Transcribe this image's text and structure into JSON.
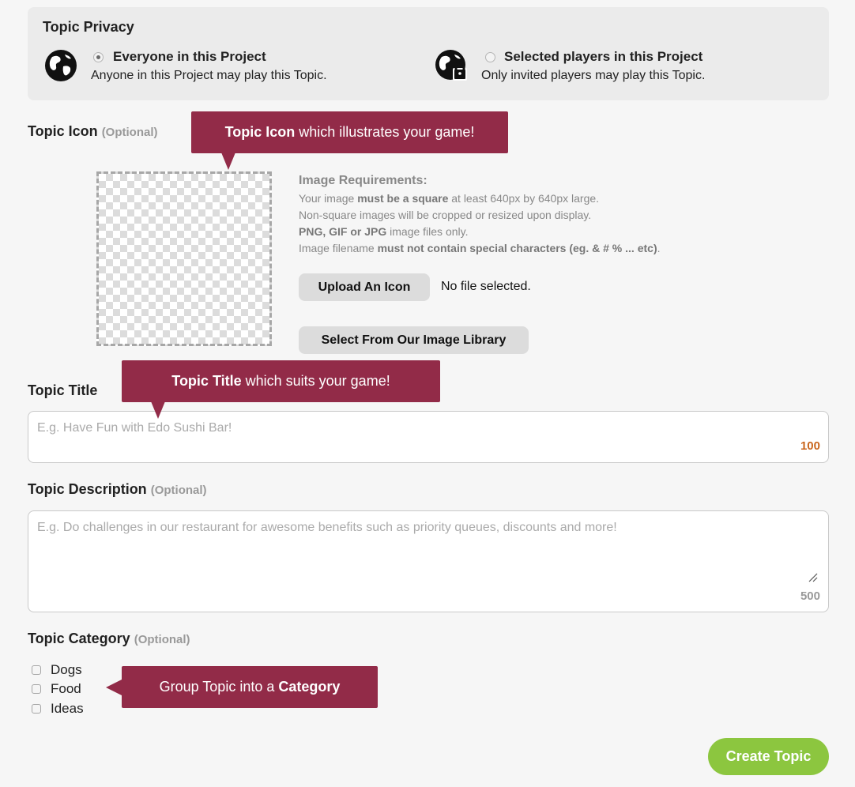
{
  "privacy": {
    "title": "Topic Privacy",
    "options": [
      {
        "title": "Everyone in this Project",
        "description": "Anyone in this Project may play this Topic.",
        "selected": true,
        "icon": "globe-icon"
      },
      {
        "title": "Selected players in this Project",
        "description": "Only invited players may play this Topic.",
        "selected": false,
        "icon": "globe-lock-icon"
      }
    ]
  },
  "icon_section": {
    "label": "Topic Icon",
    "optional": "(Optional)",
    "tooltip_bold": "Topic Icon",
    "tooltip_rest": " which illustrates your game!",
    "requirements_title": "Image Requirements:",
    "req1_a": "Your image ",
    "req1_b": "must be a square",
    "req1_c": " at least 640px by 640px large.",
    "req2": "Non-square images will be cropped or resized upon display.",
    "req3_a": "PNG, GIF or JPG",
    "req3_b": " image files only.",
    "req4_a": "Image filename ",
    "req4_b": "must not contain special characters (eg. & # % ... etc)",
    "req4_c": ".",
    "upload_button": "Upload An Icon",
    "file_status": "No file selected.",
    "library_button": "Select From Our Image Library"
  },
  "title_section": {
    "label": "Topic Title",
    "tooltip_bold": "Topic Title",
    "tooltip_rest": " which suits your game!",
    "placeholder": "E.g. Have Fun with Edo Sushi Bar!",
    "counter": "100"
  },
  "description_section": {
    "label": "Topic Description",
    "optional": "(Optional)",
    "placeholder": "E.g. Do challenges in our restaurant for awesome benefits such as priority queues, discounts and more!",
    "counter": "500"
  },
  "category_section": {
    "label": "Topic Category",
    "optional": "(Optional)",
    "items": [
      "Dogs",
      "Food",
      "Ideas"
    ],
    "tooltip_rest": "Group Topic into a ",
    "tooltip_bold": "Category"
  },
  "submit": {
    "label": "Create Topic"
  },
  "colors": {
    "tooltip": "#922b48",
    "title_counter": "#c9651c",
    "desc_counter": "#999999",
    "create_button": "#8cc63f"
  }
}
